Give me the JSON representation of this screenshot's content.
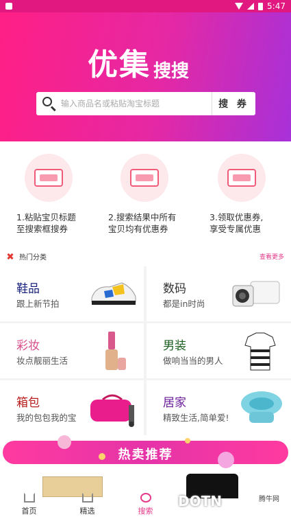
{
  "status_bar": {
    "time": "5:47",
    "app_indicator_icon": "app-notification-icon"
  },
  "brand": {
    "logo_main": "优集",
    "logo_sub": "搜搜"
  },
  "search": {
    "placeholder": "输入商品名或粘贴淘宝标题",
    "button_label": "搜 券"
  },
  "steps": [
    {
      "line1": "1.粘贴宝贝标题",
      "line2": "至搜索框搜券",
      "icon": "paste-title-icon"
    },
    {
      "line1": "2.搜索结果中所有",
      "line2": "宝贝均有优惠券",
      "icon": "coupon-results-icon"
    },
    {
      "line1": "3.领取优惠券,",
      "line2": "享受专属优惠",
      "icon": "claim-coupon-icon"
    }
  ],
  "hot_categories": {
    "title": "热门分类",
    "more": "查看更多"
  },
  "categories": [
    {
      "name": "鞋品",
      "subtitle": "跟上新节拍",
      "color": "#1a237e",
      "image_icon": "sneaker-icon"
    },
    {
      "name": "数码",
      "subtitle": "都是in时尚",
      "color": "#333333",
      "image_icon": "camera-icon"
    },
    {
      "name": "彩妆",
      "subtitle": "妆点靓丽生活",
      "color": "#d84d8a",
      "image_icon": "lipstick-icon"
    },
    {
      "name": "男装",
      "subtitle": "做响当当的男人",
      "color": "#1b5e20",
      "image_icon": "polo-shirt-icon"
    },
    {
      "name": "箱包",
      "subtitle": "我的包包我的宝",
      "color": "#b71c1c",
      "image_icon": "travel-bag-icon"
    },
    {
      "name": "居家",
      "subtitle": "精致生活,简单爱!",
      "color": "#6a1b9a",
      "image_icon": "basin-icon"
    }
  ],
  "hot_banner": {
    "label": "热卖推荐"
  },
  "tabs": [
    {
      "label": "首页",
      "icon": "home-icon"
    },
    {
      "label": "精选",
      "icon": "heart-icon"
    },
    {
      "label": "搜索",
      "icon": "search-tab-icon",
      "active": true
    },
    {
      "label": "",
      "icon": "product-icon"
    },
    {
      "label": "",
      "icon": "user-icon"
    }
  ],
  "watermark": {
    "text": "DOTN",
    "sub": "腾牛网"
  },
  "colors": {
    "accent": "#e53989",
    "hero_start": "#ff1f85",
    "hero_end": "#a731d9"
  }
}
